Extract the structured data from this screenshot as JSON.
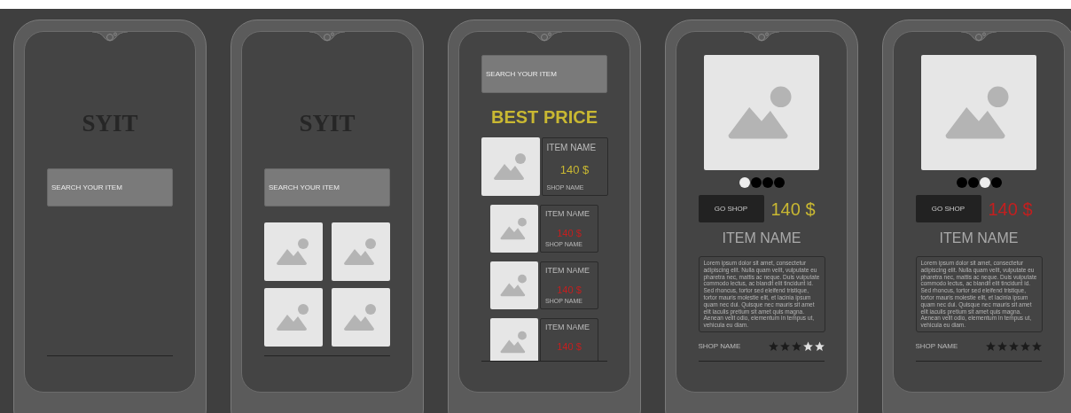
{
  "screens": [
    {
      "kind": "splash",
      "logo": "SYIT",
      "search": {
        "placeholder": "SEARCH YOUR ITEM"
      }
    },
    {
      "kind": "grid",
      "logo": "SYIT",
      "search": {
        "placeholder": "SEARCH YOUR ITEM"
      }
    },
    {
      "kind": "list",
      "search": {
        "placeholder": "SEARCH YOUR ITEM"
      },
      "heading": "BEST PRICE",
      "items": [
        {
          "name": "ITEM NAME",
          "price": "140 $",
          "shop": "SHOP NAME",
          "selected": true,
          "color": "#c9b832"
        },
        {
          "name": "ITEM NAME",
          "price": "140 $",
          "shop": "SHOP NAME",
          "selected": false,
          "color": "#c41f1f"
        },
        {
          "name": "ITEM NAME",
          "price": "140 $",
          "shop": "SHOP NAME",
          "selected": false,
          "color": "#c41f1f"
        },
        {
          "name": "ITEM NAME",
          "price": "140 $",
          "selected": false,
          "color": "#c41f1f"
        }
      ]
    },
    {
      "kind": "detail",
      "dots": [
        {
          "selected": true
        },
        {
          "selected": false
        },
        {
          "selected": false
        },
        {
          "selected": false
        }
      ],
      "button": "GO SHOP",
      "price": "140 $",
      "color": "#c9b832",
      "name": "ITEM NAME",
      "description": "Lorem ipsum dolor sit amet, consectetur adipiscing elit. Nulla quam velit, vulputate eu pharetra nec, mattis ac neque. Duis vulputate commodo lectus, ac blandit elit tincidunt id. Sed rhoncus, tortor sed eleifend tristique, tortor mauris molestie elit, et lacinia ipsum quam nec dui. Quisque nec mauris sit amet elit iaculis pretium sit amet quis magna. Aenean velit odio, elementum in tempus ut, vehicula eu diam.",
      "shop": "SHOP NAME",
      "stars": 2
    },
    {
      "kind": "detail",
      "dots": [
        {
          "selected": false
        },
        {
          "selected": false
        },
        {
          "selected": true
        },
        {
          "selected": false
        }
      ],
      "button": "GO SHOP",
      "price": "140 $",
      "color": "#c41f1f",
      "name": "ITEM NAME",
      "description": "Lorem ipsum dolor sit amet, consectetur adipiscing elit. Nulla quam velit, vulputate eu pharetra nec, mattis ac neque. Duis vulputate commodo lectus, ac blandit elit tincidunt id. Sed rhoncus, tortor sed eleifend tristique, tortor mauris molestie elit, et lacinia ipsum quam nec dui. Quisque nec mauris sit amet elit iaculis pretium sit amet quis magna. Aenean velit odio, elementum in tempus ut, vehicula eu diam.",
      "shop": "SHOP NAME",
      "stars": 0
    }
  ]
}
